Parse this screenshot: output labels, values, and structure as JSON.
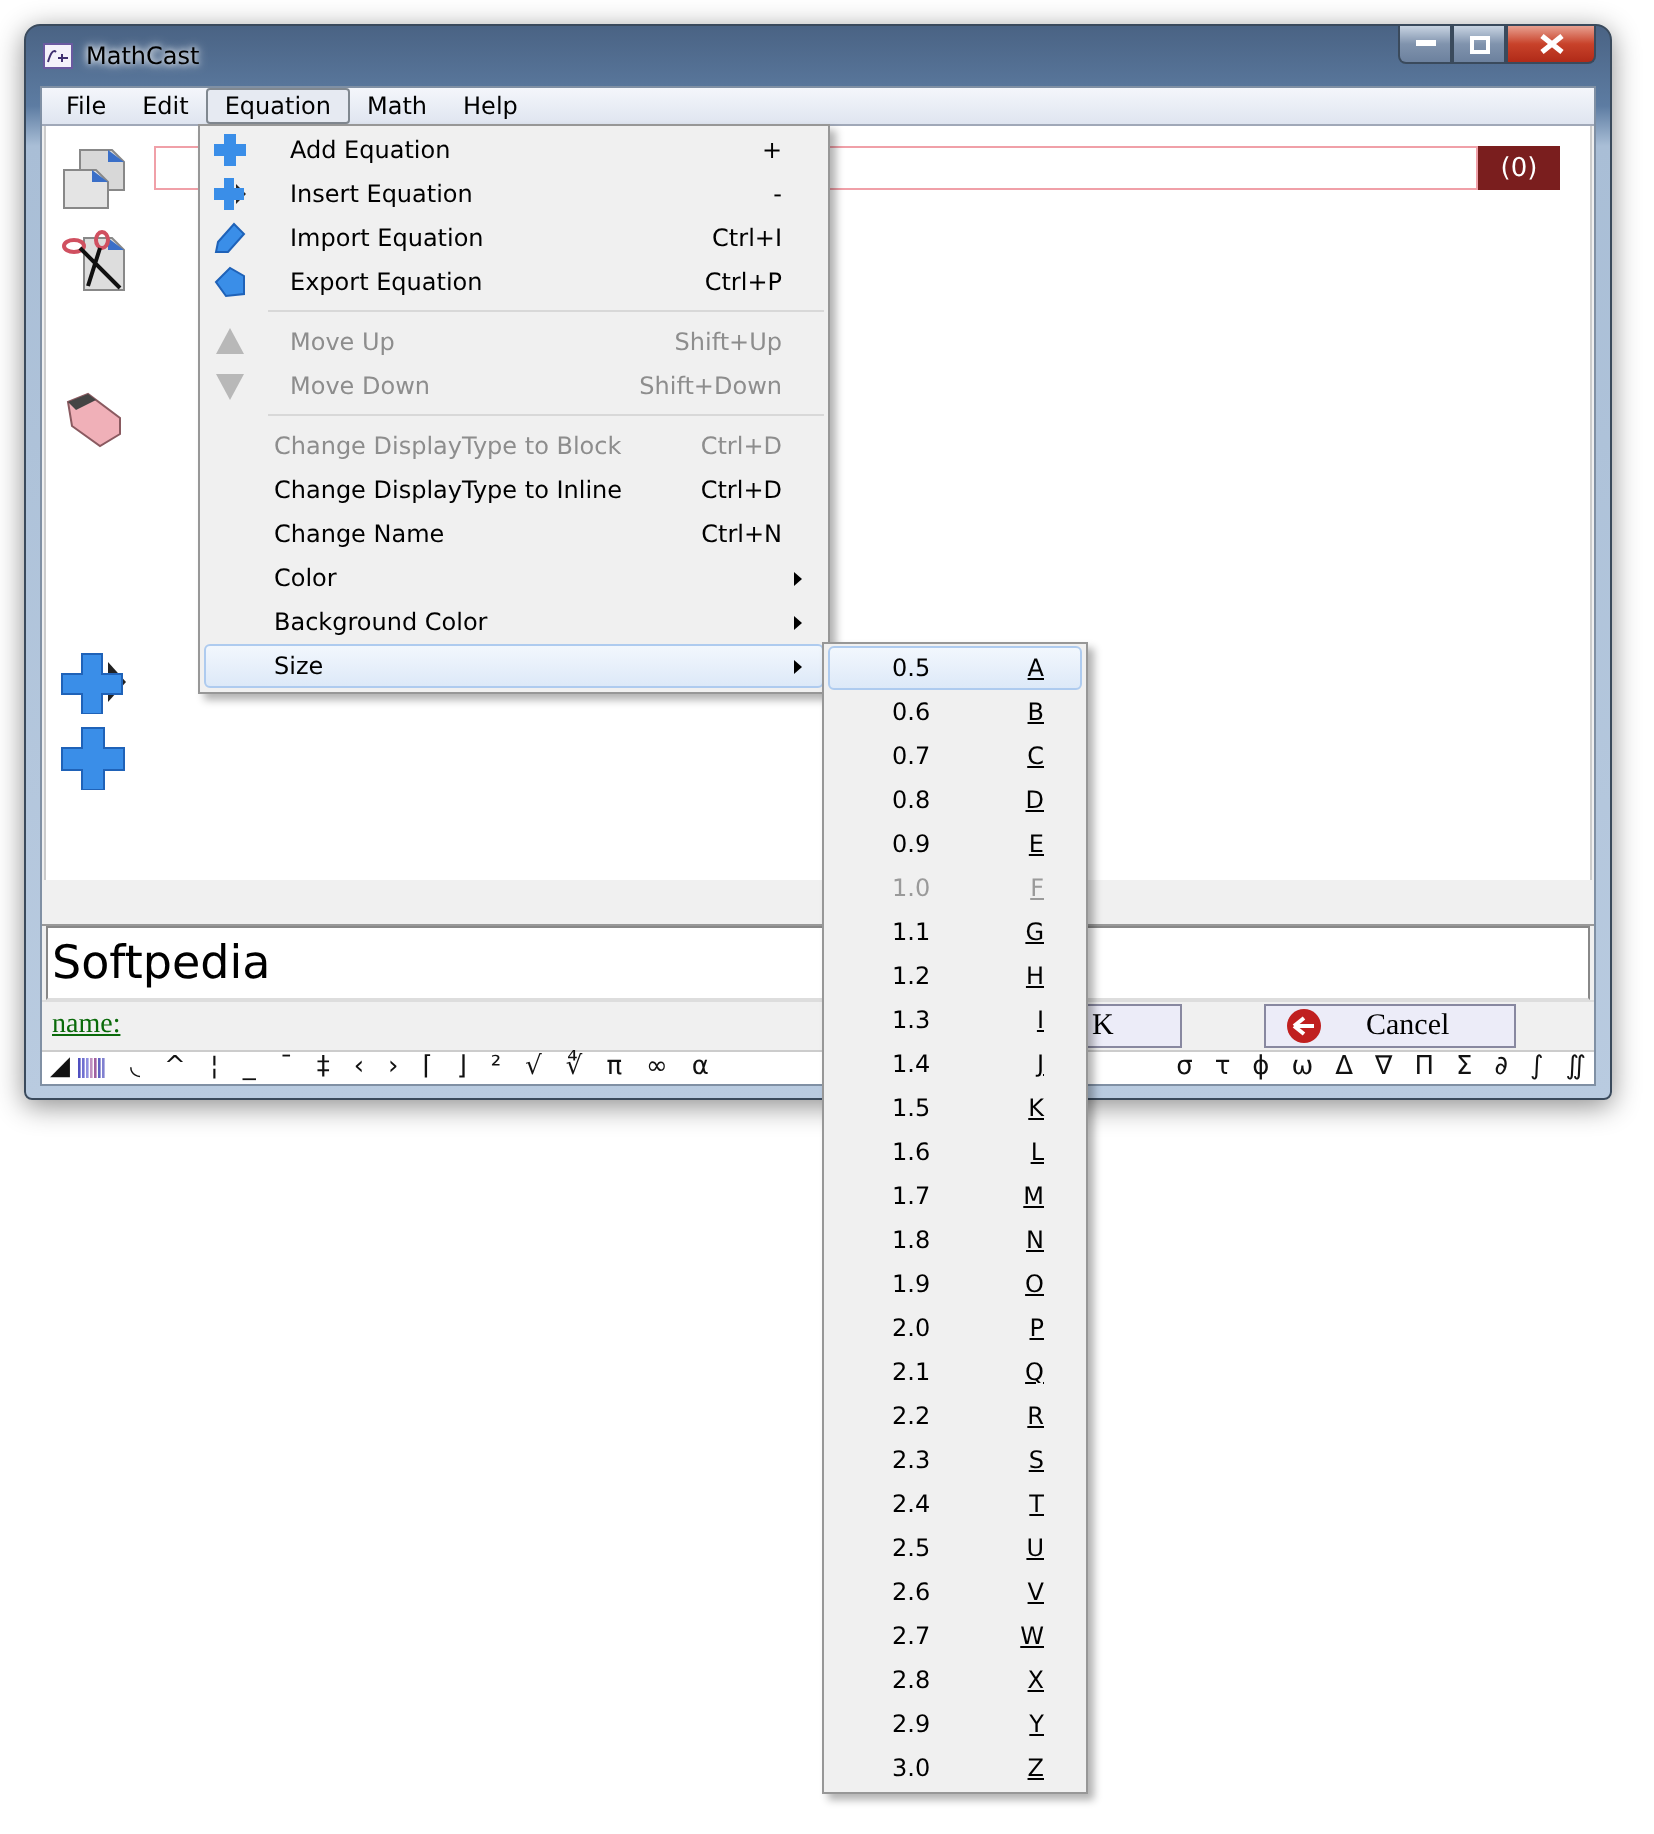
{
  "window": {
    "title": "MathCast"
  },
  "menu_bar": [
    {
      "label": "File",
      "selected": false
    },
    {
      "label": "Edit",
      "selected": false
    },
    {
      "label": "Equation",
      "selected": true
    },
    {
      "label": "Math",
      "selected": false
    },
    {
      "label": "Help",
      "selected": false
    }
  ],
  "equation": {
    "count": "(0)"
  },
  "equation_menu": [
    {
      "kind": "item",
      "label": "Add Equation",
      "shortcut": "+",
      "disabled": false,
      "selected": false
    },
    {
      "kind": "item",
      "label": "Insert Equation",
      "shortcut": "-",
      "disabled": false,
      "selected": false
    },
    {
      "kind": "item",
      "label": "Import Equation",
      "shortcut": "Ctrl+I",
      "disabled": false,
      "selected": false
    },
    {
      "kind": "item",
      "label": "Export Equation",
      "shortcut": "Ctrl+P",
      "disabled": false,
      "selected": false
    },
    {
      "kind": "separator"
    },
    {
      "kind": "item",
      "label": "Move Up",
      "shortcut": "Shift+Up",
      "disabled": true,
      "selected": false
    },
    {
      "kind": "item",
      "label": "Move Down",
      "shortcut": "Shift+Down",
      "disabled": true,
      "selected": false
    },
    {
      "kind": "separator"
    },
    {
      "kind": "item",
      "label": "Change DisplayType to Block",
      "shortcut": "Ctrl+D",
      "disabled": true,
      "selected": false
    },
    {
      "kind": "item",
      "label": "Change DisplayType to Inline",
      "shortcut": "Ctrl+D",
      "disabled": false,
      "selected": false
    },
    {
      "kind": "item",
      "label": "Change Name",
      "shortcut": "Ctrl+N",
      "disabled": false,
      "selected": false
    },
    {
      "kind": "submenu",
      "label": "Color",
      "disabled": false,
      "selected": false
    },
    {
      "kind": "submenu",
      "label": "Background Color",
      "disabled": false,
      "selected": false
    },
    {
      "kind": "submenu",
      "label": "Size",
      "disabled": false,
      "selected": true
    }
  ],
  "size_menu": [
    {
      "label": "0.5",
      "key": "A",
      "disabled": false,
      "selected": true
    },
    {
      "label": "0.6",
      "key": "B",
      "disabled": false,
      "selected": false
    },
    {
      "label": "0.7",
      "key": "C",
      "disabled": false,
      "selected": false
    },
    {
      "label": "0.8",
      "key": "D",
      "disabled": false,
      "selected": false
    },
    {
      "label": "0.9",
      "key": "E",
      "disabled": false,
      "selected": false
    },
    {
      "label": "1.0",
      "key": "F",
      "disabled": true,
      "selected": false
    },
    {
      "label": "1.1",
      "key": "G",
      "disabled": false,
      "selected": false
    },
    {
      "label": "1.2",
      "key": "H",
      "disabled": false,
      "selected": false
    },
    {
      "label": "1.3",
      "key": "I",
      "disabled": false,
      "selected": false
    },
    {
      "label": "1.4",
      "key": "J",
      "disabled": false,
      "selected": false
    },
    {
      "label": "1.5",
      "key": "K",
      "disabled": false,
      "selected": false
    },
    {
      "label": "1.6",
      "key": "L",
      "disabled": false,
      "selected": false
    },
    {
      "label": "1.7",
      "key": "M",
      "disabled": false,
      "selected": false
    },
    {
      "label": "1.8",
      "key": "N",
      "disabled": false,
      "selected": false
    },
    {
      "label": "1.9",
      "key": "O",
      "disabled": false,
      "selected": false
    },
    {
      "label": "2.0",
      "key": "P",
      "disabled": false,
      "selected": false
    },
    {
      "label": "2.1",
      "key": "Q",
      "disabled": false,
      "selected": false
    },
    {
      "label": "2.2",
      "key": "R",
      "disabled": false,
      "selected": false
    },
    {
      "label": "2.3",
      "key": "S",
      "disabled": false,
      "selected": false
    },
    {
      "label": "2.4",
      "key": "T",
      "disabled": false,
      "selected": false
    },
    {
      "label": "2.5",
      "key": "U",
      "disabled": false,
      "selected": false
    },
    {
      "label": "2.6",
      "key": "V",
      "disabled": false,
      "selected": false
    },
    {
      "label": "2.7",
      "key": "W",
      "disabled": false,
      "selected": false
    },
    {
      "label": "2.8",
      "key": "X",
      "disabled": false,
      "selected": false
    },
    {
      "label": "2.9",
      "key": "Y",
      "disabled": false,
      "selected": false
    },
    {
      "label": "3.0",
      "key": "Z",
      "disabled": false,
      "selected": false
    }
  ],
  "editor": {
    "value": "Softpedia"
  },
  "name_link": "name:",
  "ok_button": "K",
  "cancel_button": "Cancel",
  "symbols_left": [
    "◢",
    "◟",
    "^",
    "¦",
    "_",
    "¯",
    "‡",
    "‹",
    "›",
    "⌈",
    "⌋",
    "²",
    "√",
    "∜",
    "π",
    "∞",
    "α"
  ],
  "symbols_right": [
    "σ",
    "τ",
    "ϕ",
    "ω",
    "Δ",
    "∇",
    "Π",
    "Σ",
    "∂",
    "∫",
    "∬"
  ]
}
